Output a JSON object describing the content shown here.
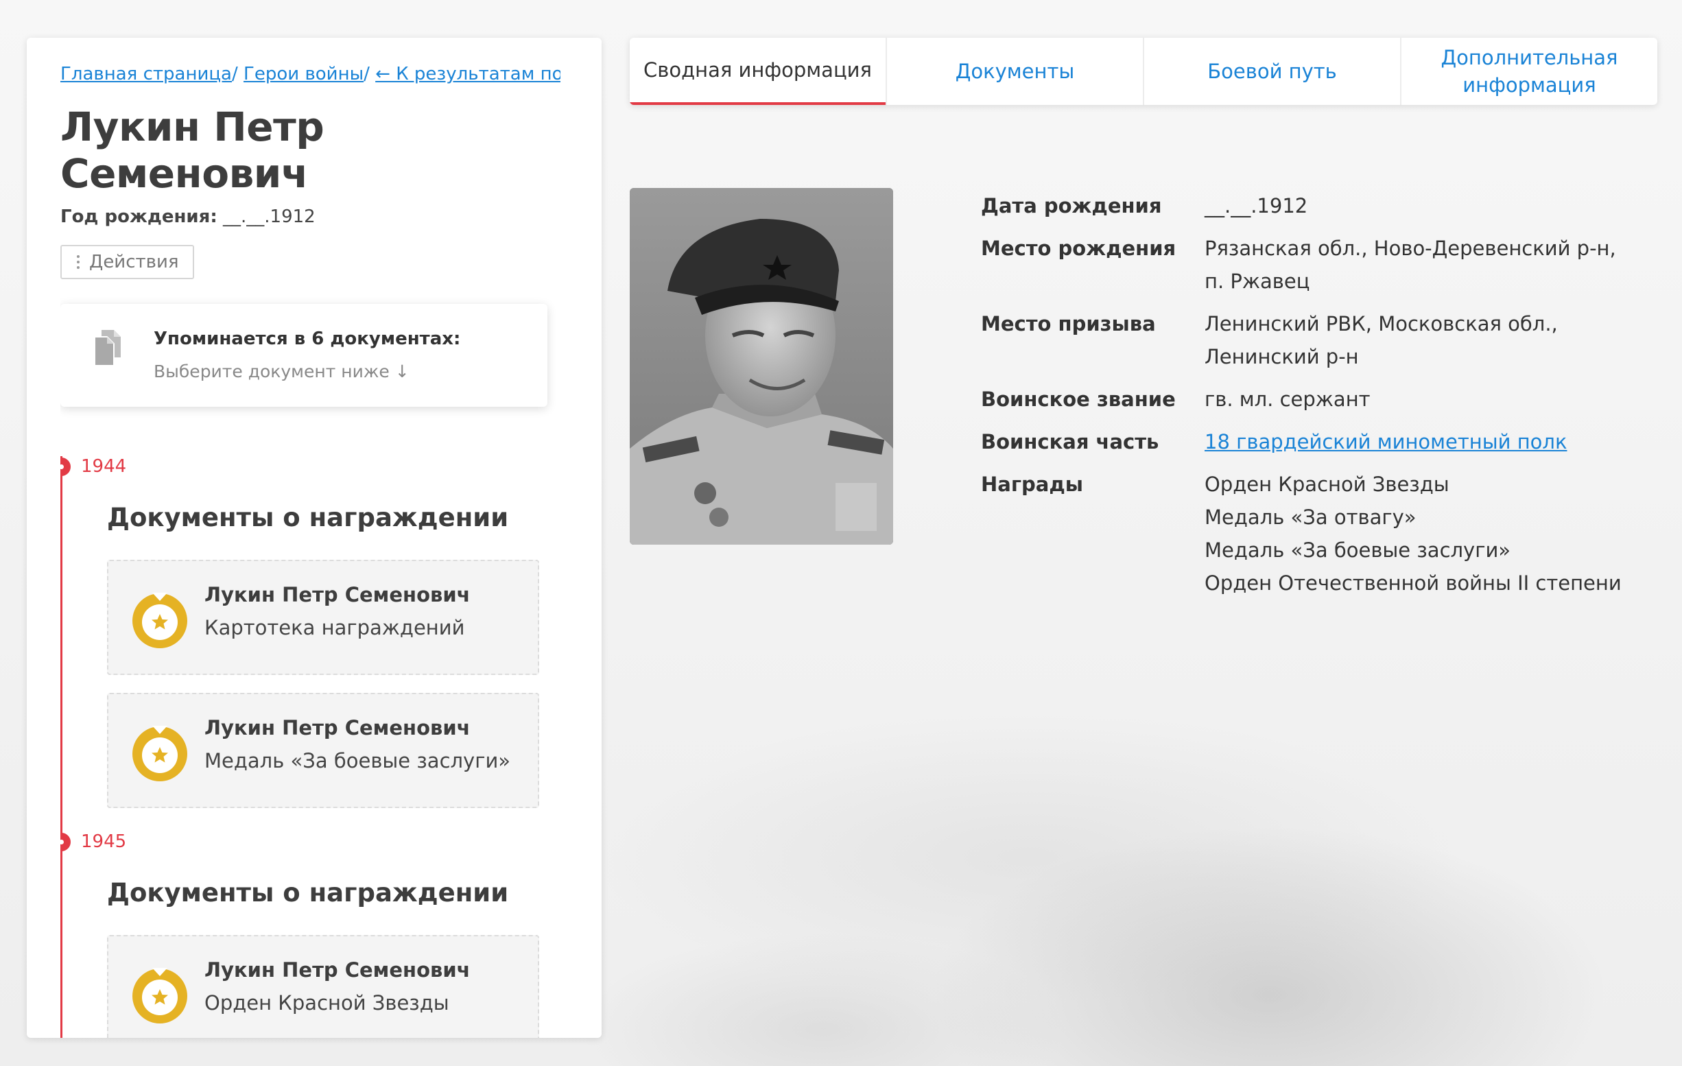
{
  "breadcrumb": {
    "home": "Главная страница",
    "sep1": "/",
    "heroes": "Герои войны",
    "sep2": "/",
    "back": "← К результатам поиска"
  },
  "hero": {
    "name": "Лукин Петр Семенович",
    "birth_label": "Год рождения:",
    "birth_value": "__.__.1912"
  },
  "actions_label": "Действия",
  "mentions": {
    "title": "Упоминается в 6 документах:",
    "subtitle": "Выберите документ ниже ↓"
  },
  "timeline": [
    {
      "year": "1944",
      "group": "Документы о награждении",
      "cards": [
        {
          "name": "Лукин Петр Семенович",
          "type": "Картотека награждений"
        },
        {
          "name": "Лукин Петр Семенович",
          "type": "Медаль «За боевые заслуги»"
        }
      ]
    },
    {
      "year": "1945",
      "group": "Документы о награждении",
      "cards": [
        {
          "name": "Лукин Петр Семенович",
          "type": "Орден Красной Звезды"
        }
      ]
    }
  ],
  "tabs": [
    "Сводная информация",
    "Документы",
    "Боевой путь",
    "Дополнительная информация"
  ],
  "info": {
    "birth_date": {
      "label": "Дата рождения",
      "value": "__.__.1912"
    },
    "birth_place": {
      "label": "Место рождения",
      "value": "Рязанская обл., Ново-Деревенский р-н, п. Ржавец"
    },
    "draft_place": {
      "label": "Место призыва",
      "value": "Ленинский РВК, Московская обл., Ленинский р-н"
    },
    "rank": {
      "label": "Воинское звание",
      "value": "гв. мл. сержант"
    },
    "unit": {
      "label": "Воинская часть",
      "value": "18 гвардейский минометный полк"
    },
    "awards": {
      "label": "Награды",
      "values": [
        "Орден Красной Звезды",
        "Медаль «За отвагу»",
        "Медаль «За боевые заслуги»",
        "Орден Отечественной войны II степени"
      ]
    }
  },
  "colors": {
    "accent": "#e23a45",
    "link": "#1a83d6",
    "medal": "#e5b224"
  },
  "icons": [
    "dots-icon",
    "document-icon",
    "medal-icon"
  ]
}
